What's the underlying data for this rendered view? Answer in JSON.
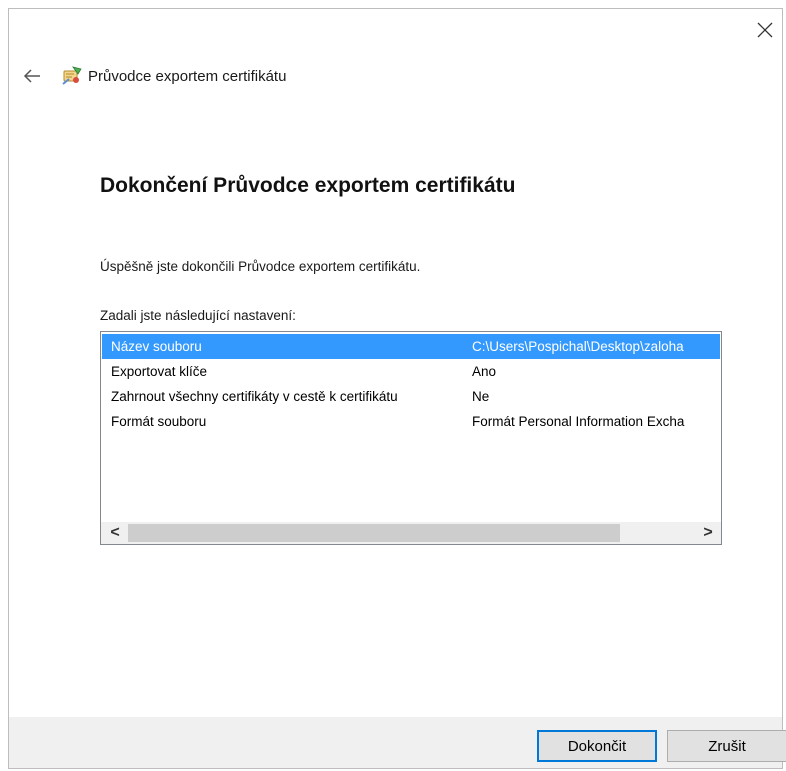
{
  "window": {
    "title": "Průvodce exportem certifikátu",
    "icons": {
      "close": "close-icon",
      "back": "back-arrow-icon",
      "wizard": "certificate-wizard-icon"
    }
  },
  "main": {
    "heading": "Dokončení Průvodce exportem certifikátu",
    "success_text": "Úspěšně jste dokončili Průvodce exportem certifikátu.",
    "settings_label": "Zadali jste následující nastavení:"
  },
  "settings_list": {
    "selected_index": 0,
    "rows": [
      {
        "name": "Název souboru",
        "value": "C:\\Users\\Pospichal\\Desktop\\zaloha"
      },
      {
        "name": "Exportovat klíče",
        "value": "Ano"
      },
      {
        "name": "Zahrnout všechny certifikáty v cestě k certifikátu",
        "value": "Ne"
      },
      {
        "name": "Formát souboru",
        "value": "Formát Personal Information Excha"
      }
    ],
    "scroll_left_glyph": "<",
    "scroll_right_glyph": ">"
  },
  "buttons": {
    "finish": "Dokončit",
    "cancel": "Zrušit"
  },
  "colors": {
    "selection": "#3399ff",
    "accent_border": "#0078d7",
    "footer_bg": "#f0f0f0"
  }
}
